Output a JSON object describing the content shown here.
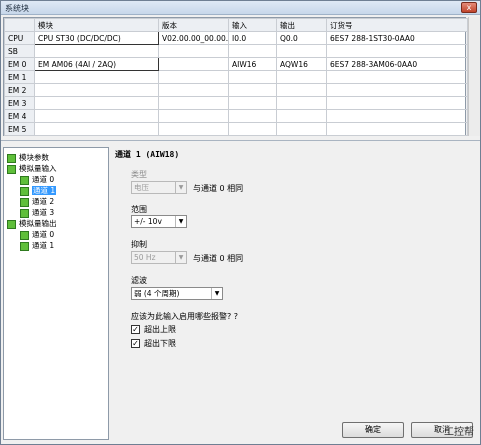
{
  "window": {
    "title": "系统块",
    "close_label": "x"
  },
  "grid": {
    "columns": [
      "",
      "模块",
      "版本",
      "输入",
      "输出",
      "订货号"
    ],
    "rows": [
      [
        "CPU",
        "CPU ST30 (DC/DC/DC)",
        "V02.00.00_00.00...",
        "I0.0",
        "Q0.0",
        "6ES7 288-1ST30-0AA0"
      ],
      [
        "SB",
        "",
        "",
        "",
        "",
        ""
      ],
      [
        "EM 0",
        "EM AM06 (4AI / 2AQ)",
        "",
        "AIW16",
        "AQW16",
        "6ES7 288-3AM06-0AA0"
      ],
      [
        "EM 1",
        "",
        "",
        "",
        "",
        ""
      ],
      [
        "EM 2",
        "",
        "",
        "",
        "",
        ""
      ],
      [
        "EM 3",
        "",
        "",
        "",
        "",
        ""
      ],
      [
        "EM 4",
        "",
        "",
        "",
        "",
        ""
      ],
      [
        "EM 5",
        "",
        "",
        "",
        "",
        ""
      ]
    ]
  },
  "tree": {
    "items": [
      {
        "label": "模块参数"
      },
      {
        "label": "模拟量输入"
      },
      {
        "label": "通道 0"
      },
      {
        "label": "通道 1"
      },
      {
        "label": "通道 2"
      },
      {
        "label": "通道 3"
      },
      {
        "label": "模拟量输出"
      },
      {
        "label": "通道 0"
      },
      {
        "label": "通道 1"
      }
    ]
  },
  "panel": {
    "heading": "通道 1 (AIW18)",
    "type_label": "类型",
    "type_value": "电压",
    "type_note": "与通道 0 相同",
    "range_label": "范围",
    "range_value": "+/- 10v",
    "suppress_label": "抑制",
    "suppress_value": "50 Hz",
    "suppress_note": "与通道 0 相同",
    "filter_label": "滤波",
    "filter_value": "弱 (4 个周期)",
    "alarm_question": "应该为此输入启用哪些报警? ?",
    "alarm_upper": "超出上限",
    "alarm_lower": "超出下限"
  },
  "buttons": {
    "ok": "确定",
    "cancel": "取消"
  },
  "watermark": "工控帮"
}
